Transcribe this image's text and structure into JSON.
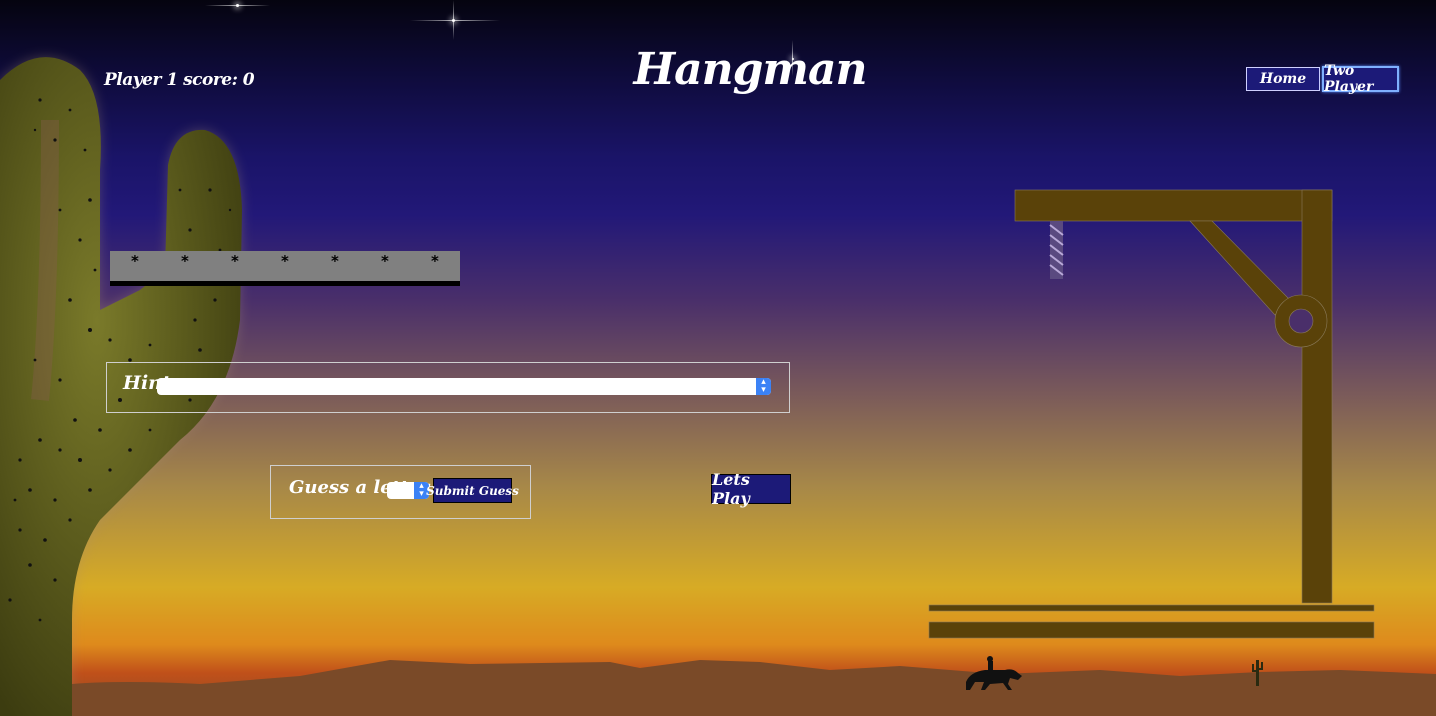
{
  "header": {
    "score_label": "Player 1 score: 0",
    "title": "Hangman"
  },
  "nav": {
    "home_label": "Home",
    "two_player_label": "Two Player"
  },
  "word": {
    "masked_letters": [
      "*",
      "*",
      "*",
      "*",
      "*",
      "*",
      "*"
    ]
  },
  "hint": {
    "label": "Hint",
    "selected_value": ""
  },
  "guess": {
    "label": "Guess a letter",
    "selected_value": "",
    "submit_label": "Submit Guess"
  },
  "play": {
    "label": "Lets Play"
  },
  "colors": {
    "button_bg": "#1c1a78",
    "gallows_wood": "#5a4209",
    "desert_ground": "#7a4a28",
    "cactus": "#5a5a18"
  },
  "icons": {
    "gallows": "gallows-icon",
    "cactus": "cactus-icon",
    "rider": "horse-rider-icon",
    "small_cactus": "small-cactus-icon"
  }
}
